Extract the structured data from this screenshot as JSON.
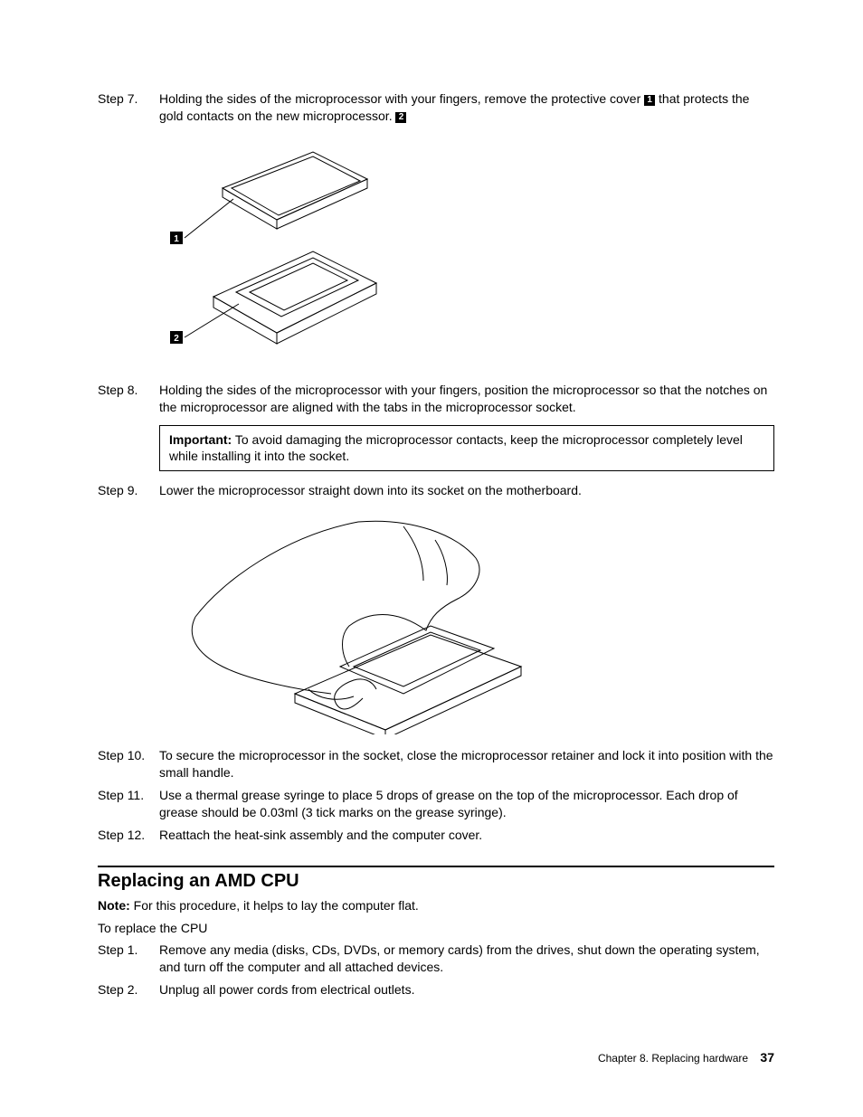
{
  "steps_a": [
    {
      "label": "Step 7.",
      "pre": "Holding the sides of the microprocessor with your fingers, remove the protective cover ",
      "mid": " that protects the gold contacts on the new microprocessor. ",
      "c1": "1",
      "c2": "2"
    }
  ],
  "steps_b": [
    {
      "label": "Step 8.",
      "text": "Holding the sides of the microprocessor with your fingers, position the microprocessor so that the notches on the microprocessor are aligned with the tabs in the microprocessor socket."
    }
  ],
  "notice": {
    "label": "Important:",
    "text": " To avoid damaging the microprocessor contacts, keep the microprocessor completely level while installing it into the socket."
  },
  "steps_c": [
    {
      "label": "Step 9.",
      "text": "Lower the microprocessor straight down into its socket on the motherboard."
    }
  ],
  "steps_d": [
    {
      "label": "Step 10.",
      "text": "To secure the microprocessor in the socket, close the microprocessor retainer and lock it into position with the small handle."
    },
    {
      "label": "Step 11.",
      "text": "Use a thermal grease syringe to place 5 drops of grease on the top of the microprocessor. Each drop of grease should be 0.03ml (3 tick marks on the grease syringe)."
    },
    {
      "label": "Step 12.",
      "text": "Reattach the heat-sink assembly and the computer cover."
    }
  ],
  "section_heading": "Replacing an AMD CPU",
  "note": {
    "label": "Note:",
    "text": " For this procedure, it helps to lay the computer flat."
  },
  "intro": "To replace the CPU",
  "steps_e": [
    {
      "label": "Step 1.",
      "text": "Remove any media (disks, CDs, DVDs, or memory cards) from the drives, shut down the operating system, and turn off the computer and all attached devices."
    },
    {
      "label": "Step 2.",
      "text": "Unplug all power cords from electrical outlets."
    }
  ],
  "footer": {
    "chapter": "Chapter 8. Replacing hardware",
    "page": "37"
  },
  "fig1": {
    "c1": "1",
    "c2": "2"
  }
}
